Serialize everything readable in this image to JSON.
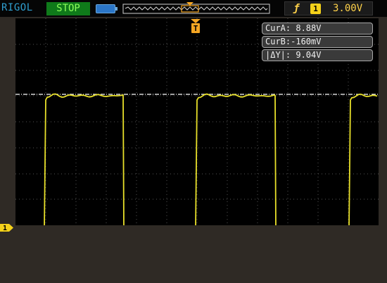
{
  "topbar": {
    "brand": "RIGOL",
    "run_state": "STOP",
    "trigger": {
      "edge_icon": "rising-edge-icon",
      "source": "1",
      "level": "3.00V"
    }
  },
  "trigger_marker": {
    "label": "T"
  },
  "cursors": {
    "cur_a": "CurA: 8.88V",
    "cur_b": "CurB:-160mV",
    "delta_y": "|ΔY|: 9.04V"
  },
  "channel_marker": {
    "label": "1"
  },
  "colors": {
    "trace": "#e8e02a",
    "grid": "#5a5a5a",
    "brand": "#2f9fd0",
    "run_state_bg": "#0f7a1a",
    "trigger": "#f5a623"
  },
  "waveform": {
    "type": "square",
    "high_level_V": 8.88,
    "low_level_V": -0.16,
    "cursor_a_V": 8.88,
    "cursor_b_V": -0.16
  }
}
